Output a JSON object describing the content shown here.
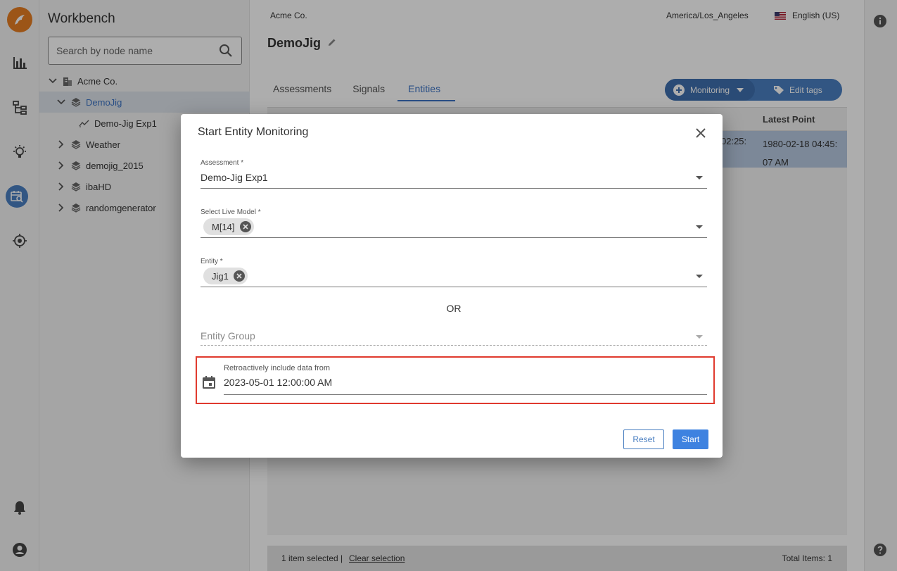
{
  "app": {
    "title": "Workbench",
    "search_placeholder": "Search by node name"
  },
  "tree": {
    "root": "Acme Co.",
    "selected": "DemoJig",
    "child": "Demo-Jig Exp1",
    "nodes": [
      "Weather",
      "demojig_2015",
      "ibaHD",
      "randomgenerator"
    ]
  },
  "header": {
    "org": "Acme Co.",
    "timezone": "America/Los_Angeles",
    "language": "English (US)",
    "page_title": "DemoJig"
  },
  "tabs": [
    "Assessments",
    "Signals",
    "Entities"
  ],
  "active_tab": "Entities",
  "toolbar": {
    "monitoring_label": "Monitoring",
    "edit_tags_label": "Edit tags"
  },
  "grid": {
    "column_latest_point": "Latest Point",
    "row_partial_value": "02:25:",
    "row_latest_point": "1980-02-18 04:45: 07 AM"
  },
  "footer": {
    "selected_text": "1 item selected |",
    "clear_label": "Clear selection",
    "total_text": "Total Items: 1"
  },
  "dialog": {
    "title": "Start Entity Monitoring",
    "assessment_label": "Assessment *",
    "assessment_value": "Demo-Jig Exp1",
    "live_model_label": "Select Live Model *",
    "live_model_chip": "M[14]",
    "entity_label": "Entity *",
    "entity_chip": "Jig1",
    "or_text": "OR",
    "entity_group_placeholder": "Entity Group",
    "retro_label": "Retroactively include data from",
    "retro_value": "2023-05-01 12:00:00 AM",
    "reset_label": "Reset",
    "start_label": "Start"
  },
  "colors": {
    "accent": "#3e82e0",
    "highlight_border": "#e03a2e",
    "logo": "#e67e22"
  }
}
